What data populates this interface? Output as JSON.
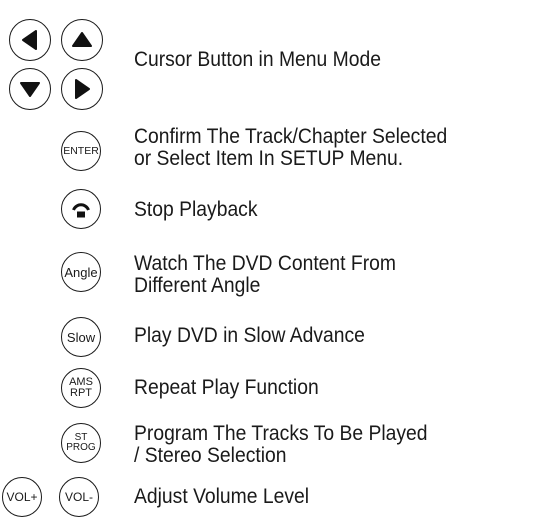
{
  "rows": [
    {
      "description": [
        "Cursor Button in Menu Mode"
      ],
      "buttons": [
        {
          "icon": "left-arrow-icon"
        },
        {
          "icon": "up-arrow-icon"
        },
        {
          "icon": "down-arrow-icon"
        },
        {
          "icon": "right-arrow-icon"
        }
      ]
    },
    {
      "description": [
        "Confirm The Track/Chapter Selected",
        "or Select Item In SETUP Menu."
      ],
      "buttons": [
        {
          "label": "ENTER"
        }
      ]
    },
    {
      "description": [
        "Stop Playback"
      ],
      "buttons": [
        {
          "icon": "stop-icon"
        }
      ]
    },
    {
      "description": [
        "Watch The DVD Content From",
        "Different Angle"
      ],
      "buttons": [
        {
          "label": "Angle"
        }
      ]
    },
    {
      "description": [
        "Play DVD in Slow Advance"
      ],
      "buttons": [
        {
          "label": "Slow"
        }
      ]
    },
    {
      "description": [
        "Repeat Play Function"
      ],
      "buttons": [
        {
          "label_top": "AMS",
          "label_bottom": "RPT"
        }
      ]
    },
    {
      "description": [
        "Program The Tracks To Be Played",
        "/ Stereo Selection"
      ],
      "buttons": [
        {
          "label_top": "ST",
          "label_bottom": "PROG"
        }
      ]
    },
    {
      "description": [
        "Adjust Volume Level"
      ],
      "buttons": [
        {
          "label": "VOL+"
        },
        {
          "label": "VOL-"
        }
      ]
    }
  ]
}
